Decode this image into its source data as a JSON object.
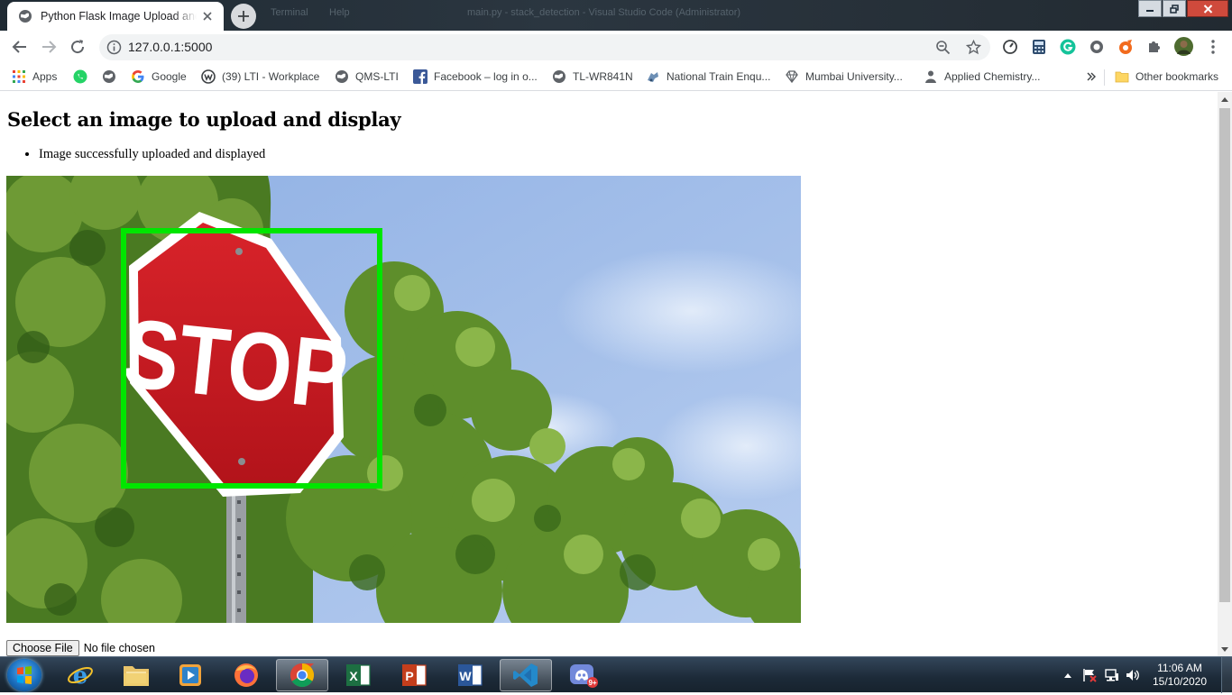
{
  "browser": {
    "tab_title": "Python Flask Image Upload and Display",
    "background_window_texts": [
      "Terminal",
      "Help",
      "main.py - stack_detection - Visual Studio Code (Administrator)"
    ],
    "url": "127.0.0.1:5000"
  },
  "bookmarks": [
    {
      "label": "Apps",
      "icon": "apps-grid-icon"
    },
    {
      "label": "",
      "icon": "whatsapp-icon"
    },
    {
      "label": "",
      "icon": "globe-icon"
    },
    {
      "label": "Google",
      "icon": "google-icon"
    },
    {
      "label": "(39) LTI - Workplace",
      "icon": "workplace-icon"
    },
    {
      "label": "QMS-LTI",
      "icon": "globe-icon"
    },
    {
      "label": "Facebook – log in o...",
      "icon": "facebook-icon"
    },
    {
      "label": "TL-WR841N",
      "icon": "globe-icon"
    },
    {
      "label": "National Train Enqu...",
      "icon": "train-icon"
    },
    {
      "label": "Mumbai University...",
      "icon": "diamond-icon"
    },
    {
      "label": "Applied Chemistry...",
      "icon": "person-icon"
    }
  ],
  "other_bookmarks": "Other bookmarks",
  "page": {
    "heading": "Select an image to upload and display",
    "messages": [
      "Image successfully uploaded and displayed"
    ],
    "sign_text": "STOP",
    "file_button": "Choose File",
    "file_status": "No file chosen"
  },
  "taskbar": {
    "time": "11:06 AM",
    "date": "15/10/2020",
    "notification_badge": "9+"
  },
  "colors": {
    "detection_box": "#00e600",
    "stop_sign": "#c8161d",
    "sky": "#a9c4ea",
    "foliage": "#4f7d27"
  }
}
